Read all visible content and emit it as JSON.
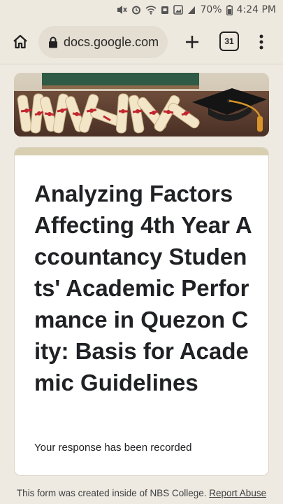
{
  "status_bar": {
    "battery": "70%",
    "time": "4:24 PM"
  },
  "browser": {
    "url": "docs.google.com",
    "tab_count": "31"
  },
  "icons": {
    "home": "home-icon",
    "lock": "lock-icon",
    "new_tab": "plus-icon",
    "menu": "more-vert-icon"
  },
  "form": {
    "title": "Analyzing Factors Affecting 4th Year Accountancy Students' Academic Performance in Quezon City: Basis for Academic Guidelines",
    "confirmation": "Your response has been recorded"
  },
  "footer": {
    "text": "This form was created inside of NBS College.",
    "link": "Report Abuse"
  },
  "colors": {
    "page_bg": "#efeae1",
    "header_accent": "#d8ceb0"
  }
}
